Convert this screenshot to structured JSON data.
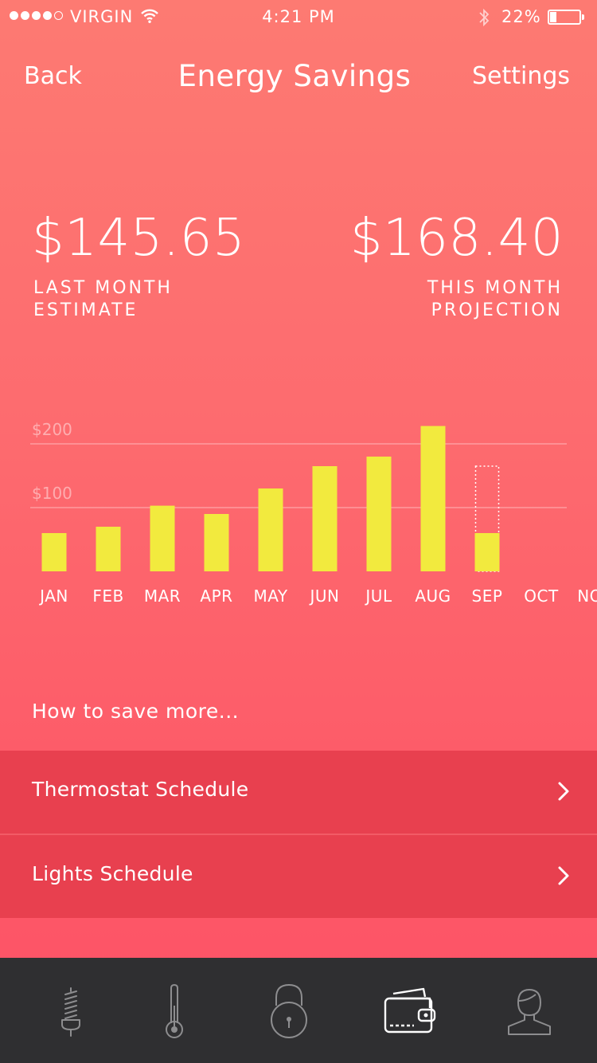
{
  "status_bar": {
    "carrier": "VIRGIN",
    "time": "4:21 PM",
    "battery": "22%",
    "signal_dots_filled": 4,
    "signal_dots_total": 5,
    "battery_level": 0.22
  },
  "nav": {
    "back_label": "Back",
    "title": "Energy Savings",
    "settings_label": "Settings"
  },
  "summary": {
    "last_month": {
      "amount": "$145.65",
      "caption_line1": "LAST MONTH",
      "caption_line2": "ESTIMATE"
    },
    "this_month": {
      "amount": "$168.40",
      "caption_line1": "THIS MONTH",
      "caption_line2": "PROJECTION"
    }
  },
  "chart_data": {
    "type": "bar",
    "categories": [
      "JAN",
      "FEB",
      "MAR",
      "APR",
      "MAY",
      "JUN",
      "JUL",
      "AUG",
      "SEP",
      "OCT",
      "NOV"
    ],
    "values": [
      60,
      70,
      103,
      90,
      130,
      165,
      180,
      228,
      60,
      null,
      null
    ],
    "projected": [
      null,
      null,
      null,
      null,
      null,
      null,
      null,
      null,
      165,
      null,
      null
    ],
    "ytick_labels": [
      "$100",
      "$200"
    ],
    "yticks": [
      100,
      200
    ],
    "ylim": [
      0,
      230
    ],
    "bar_color": "#f2ea3e",
    "grid": true
  },
  "tips": {
    "heading": "How to save more...",
    "items": [
      {
        "label": "Thermostat Schedule"
      },
      {
        "label": "Lights Schedule"
      }
    ]
  },
  "tab_bar": {
    "tabs": [
      {
        "icon": "bulb-icon",
        "active": false
      },
      {
        "icon": "thermometer-icon",
        "active": false
      },
      {
        "icon": "lock-icon",
        "active": false
      },
      {
        "icon": "wallet-icon",
        "active": true
      },
      {
        "icon": "profile-icon",
        "active": false
      }
    ]
  },
  "colors": {
    "background_top": "#fd7a72",
    "background_bottom": "#fd5166",
    "row_background": "#e8404f",
    "tab_bar": "#2f2f31",
    "bar": "#f2ea3e"
  }
}
